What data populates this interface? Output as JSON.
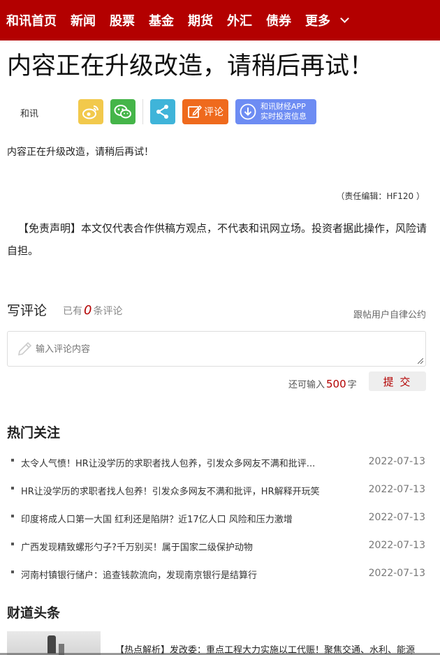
{
  "nav": {
    "items": [
      "和讯首页",
      "新闻",
      "股票",
      "基金",
      "期货",
      "外汇",
      "债券",
      "更多"
    ]
  },
  "article": {
    "title": "内容正在升级改造，请稍后再试！",
    "source": "和讯",
    "body": "内容正在升级改造，请稍后再试！",
    "editor": "（责任编辑：HF120 ）",
    "disclaimer": "【免责声明】本文仅代表合作供稿方观点，不代表和讯网立场。投资者据此操作，风险请自担。"
  },
  "share": {
    "comment_label": "评论",
    "app_line1": "和讯财经APP",
    "app_line2": "实时投资信息"
  },
  "comments": {
    "heading": "写评论",
    "count_prefix": "已有",
    "count": "0",
    "count_suffix": "条评论",
    "rules_link": "跟帖用户自律公约",
    "placeholder": "输入评论内容",
    "remain_prefix": "还可输入",
    "remain_count": "500",
    "remain_suffix": "字",
    "submit_label": "提 交"
  },
  "hot": {
    "heading": "热门关注",
    "items": [
      {
        "title": "太令人气愤！HR让没学历的求职者找人包养，引发众多网友不满和批评...",
        "date": "2022-07-13"
      },
      {
        "title": "HR让没学历的求职者找人包养！引发众多网友不满和批评，HR解释开玩笑",
        "date": "2022-07-13"
      },
      {
        "title": "印度将成人口第一大国 红利还是陷阱？近17亿人口 风险和压力激增",
        "date": "2022-07-13"
      },
      {
        "title": "广西发现精致螺形勺子?千万别买！属于国家二级保护动物",
        "date": "2022-07-13"
      },
      {
        "title": "河南村镇银行储户：追查钱款流向，发现南京银行是结算行",
        "date": "2022-07-13"
      }
    ]
  },
  "caidao": {
    "heading": "财道头条",
    "first_headline": "【热点解析】发改委：重点工程大力实施以工代赈！聚焦交通、水利、能源"
  },
  "colors": {
    "brand_red": "#b30000",
    "weibo": "#f2c94c",
    "wechat": "#45b549",
    "share": "#3fb4d9",
    "comment": "#ef6a1d",
    "app": "#6d8cf3"
  }
}
